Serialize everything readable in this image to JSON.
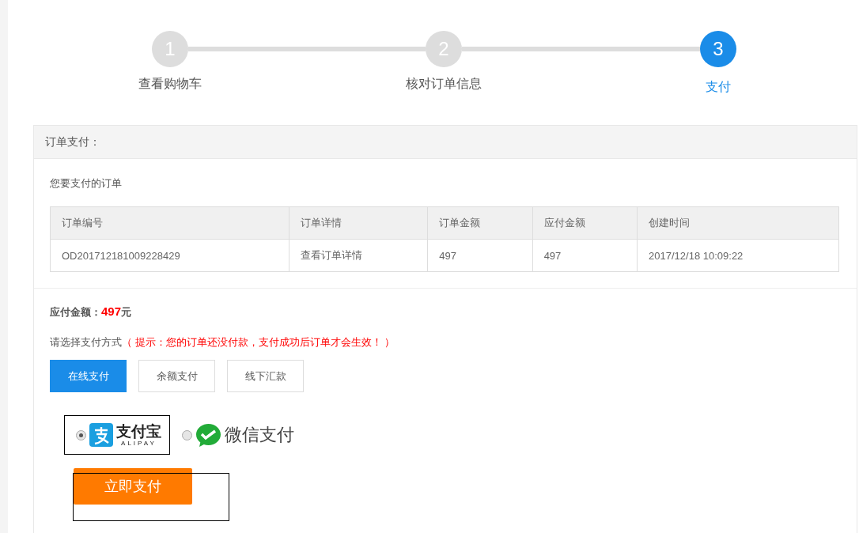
{
  "steps": [
    {
      "number": "1",
      "label": "查看购物车",
      "selected": false
    },
    {
      "number": "2",
      "label": "核对订单信息",
      "selected": false
    },
    {
      "number": "3",
      "label": "支付",
      "selected": true
    }
  ],
  "panel": {
    "title": "订单支付：",
    "subtitle": "您要支付的订单",
    "table": {
      "columns": [
        "订单编号",
        "订单详情",
        "订单金额",
        "应付金额",
        "创建时间"
      ],
      "rows": [
        {
          "cells": [
            {
              "text": "OD201712181009228429"
            },
            {
              "text": "查看订单详情"
            },
            {
              "text": "497"
            },
            {
              "text": "497"
            },
            {
              "text": "2017/12/18 10:09:22"
            }
          ]
        }
      ]
    },
    "amount": {
      "label": "应付金额：",
      "value": "497",
      "unit": "元"
    },
    "method_prompt": {
      "label": "请选择支付方式",
      "hint": "（ 提示：您的订单还没付款，支付成功后订单才会生效！ ）"
    },
    "method_tabs": [
      {
        "label": "在线支付",
        "selected": true
      },
      {
        "label": "余额支付",
        "selected": false
      },
      {
        "label": "线下汇款",
        "selected": false
      }
    ],
    "providers": [
      {
        "kind": "alipay",
        "name": "支付宝",
        "subname": "ALIPAY",
        "selected": true
      },
      {
        "kind": "wechat",
        "name": "微信支付",
        "selected": false
      }
    ],
    "pay_button": "立即支付"
  }
}
